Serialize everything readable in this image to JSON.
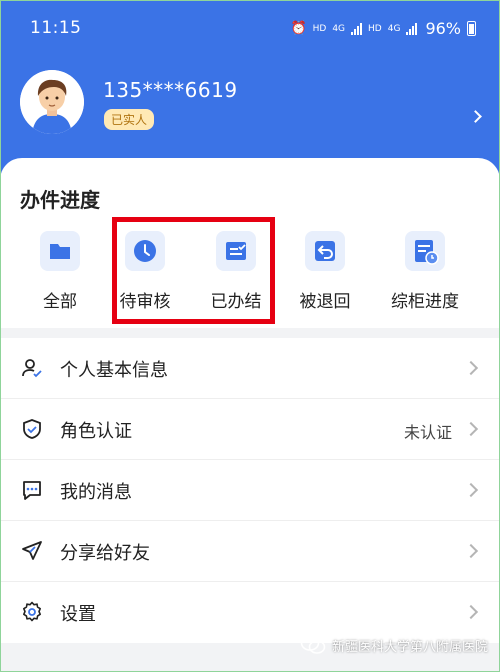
{
  "status_bar": {
    "time": "11:15",
    "hd1": "HD",
    "net1": "4G",
    "hd2": "HD",
    "net2": "4G",
    "battery": "96%"
  },
  "profile": {
    "phone": "135****6619",
    "badge": "已实人"
  },
  "progress": {
    "title": "办件进度",
    "items": [
      {
        "label": "全部",
        "icon": "folder-icon"
      },
      {
        "label": "待审核",
        "icon": "clock-icon"
      },
      {
        "label": "已办结",
        "icon": "completed-doc-icon"
      },
      {
        "label": "被退回",
        "icon": "return-arrow-icon"
      },
      {
        "label": "综柜进度",
        "icon": "schedule-icon"
      }
    ],
    "highlighted": [
      "待审核",
      "已办结"
    ]
  },
  "menu": {
    "items": [
      {
        "label": "个人基本信息",
        "value": "",
        "icon": "user-check-icon"
      },
      {
        "label": "角色认证",
        "value": "未认证",
        "icon": "shield-check-icon"
      },
      {
        "label": "我的消息",
        "value": "",
        "icon": "message-icon"
      },
      {
        "label": "分享给好友",
        "value": "",
        "icon": "share-icon"
      },
      {
        "label": "设置",
        "value": "",
        "icon": "gear-icon"
      }
    ]
  },
  "watermark": {
    "text": "新疆医科大学第八附属医院"
  },
  "colors": {
    "header": "#3b73e6",
    "icon_blue": "#3b73e6",
    "icon_bg": "#e8effc",
    "badge_bg": "#ffe9b5",
    "badge_text": "#b07410",
    "highlight": "#e60012"
  }
}
